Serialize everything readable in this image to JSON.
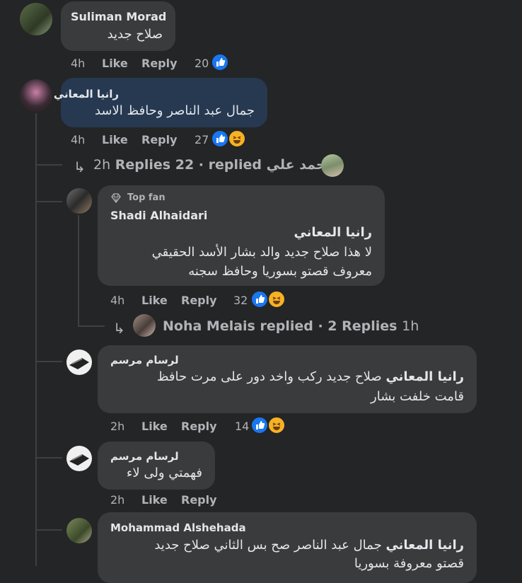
{
  "colors": {
    "background": "#242526",
    "bubble": "#3a3b3c",
    "bubble_highlight": "#263951",
    "like_blue": "#1877f2",
    "haha_yellow": "#f7b125"
  },
  "comments": [
    {
      "author": "Suliman Morad",
      "text": "صلاح جديد",
      "time": "4h",
      "like": "Like",
      "reply": "Reply",
      "count": "20",
      "reactions": [
        "like-icon"
      ]
    },
    {
      "author": "رانيا المعاني",
      "text": "جمال عبد الناصر وحافظ الاسد",
      "time": "4h",
      "like": "Like",
      "reply": "Reply",
      "count": "27",
      "reactions": [
        "like-icon",
        "haha-icon"
      ]
    }
  ],
  "thread_summary": {
    "time": "2h",
    "replies": "Replies 22",
    "sep": "·",
    "replied_by": "replied محمد علي"
  },
  "replies": [
    {
      "badge": "Top fan",
      "author": "Shadi Alhaidari",
      "mention": "رانيا المعاني",
      "lines": [
        "لا هذا صلاح جديد والد بشار الأسد الحقيقي",
        "معروف قصتو بسوريا وحافظ سجنه"
      ],
      "time": "4h",
      "like": "Like",
      "reply": "Reply",
      "count": "32"
    },
    {
      "author": "لرسام مرسم",
      "mention": "رانيا المعاني",
      "lines": [
        "صلاح جديد ركب واخد دور على مرت حافظ",
        "قامت خلفت بشار"
      ],
      "time": "2h",
      "like": "Like",
      "reply": "Reply",
      "count": "14"
    },
    {
      "author": "لرسام مرسم",
      "lines": [
        "فهمتي ولى لاء"
      ],
      "time": "2h",
      "like": "Like",
      "reply": "Reply"
    },
    {
      "author": "Mohammad Alshehada",
      "mention": "رانيا المعاني",
      "lines": [
        "جمال عبد الناصر صح بس الثاني صلاح جديد",
        "قصتو معروفة بسوريا"
      ]
    }
  ],
  "nested_summary": {
    "text": "Noha Melais replied · 2 Replies",
    "time": "1h"
  }
}
